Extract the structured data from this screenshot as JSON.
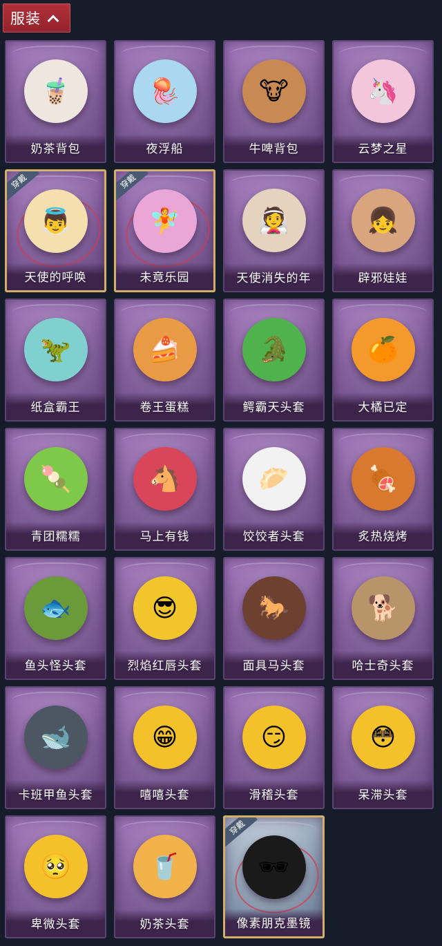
{
  "header": {
    "title": "服装"
  },
  "worn_tag": "穿戴",
  "items": [
    {
      "name": "奶茶背包",
      "icon": "milk-tea-backpack-icon",
      "color": "#f0e6e0",
      "glyph": "🧋",
      "state": "normal"
    },
    {
      "name": "夜浮船",
      "icon": "jellyfish-icon",
      "color": "#a9d8f0",
      "glyph": "🪼",
      "state": "normal"
    },
    {
      "name": "牛啤背包",
      "icon": "cow-beer-barrel-icon",
      "color": "#c88a52",
      "glyph": "🐮",
      "state": "normal"
    },
    {
      "name": "云梦之星",
      "icon": "unicorn-cloud-icon",
      "color": "#f4c6dc",
      "glyph": "🦄",
      "state": "normal"
    },
    {
      "name": "天使的呼唤",
      "icon": "angel-doll-icon",
      "color": "#f6dfae",
      "glyph": "👼",
      "state": "worn"
    },
    {
      "name": "未竟乐园",
      "icon": "pink-hair-doll-icon",
      "color": "#e9a6d6",
      "glyph": "🧚",
      "state": "worn"
    },
    {
      "name": "天使消失的年",
      "icon": "veiled-angel-doll-icon",
      "color": "#e6d3bf",
      "glyph": "👰",
      "state": "normal"
    },
    {
      "name": "辟邪娃娃",
      "icon": "bun-hair-doll-icon",
      "color": "#d9a57e",
      "glyph": "👧",
      "state": "normal"
    },
    {
      "name": "纸盒霸王",
      "icon": "cardboard-dino-icon",
      "color": "#7fd0cf",
      "glyph": "🦖",
      "state": "normal"
    },
    {
      "name": "卷王蛋糕",
      "icon": "roll-cake-icon",
      "color": "#e99a45",
      "glyph": "🍰",
      "state": "normal"
    },
    {
      "name": "鳄霸天头套",
      "icon": "crocodile-head-icon",
      "color": "#4fb24d",
      "glyph": "🐊",
      "state": "normal"
    },
    {
      "name": "大橘已定",
      "icon": "orange-slice-icon",
      "color": "#f49a2c",
      "glyph": "🍊",
      "state": "normal"
    },
    {
      "name": "青团糯糯",
      "icon": "green-rice-ball-icon",
      "color": "#7ec94a",
      "glyph": "🍡",
      "state": "normal"
    },
    {
      "name": "马上有钱",
      "icon": "red-horse-head-icon",
      "color": "#d9465a",
      "glyph": "🐴",
      "state": "normal"
    },
    {
      "name": "饺饺者头套",
      "icon": "dumpling-head-icon",
      "color": "#f2f2f2",
      "glyph": "🥟",
      "state": "normal"
    },
    {
      "name": "炙热烧烤",
      "icon": "bbq-meat-icon",
      "color": "#d9782f",
      "glyph": "🍖",
      "state": "normal"
    },
    {
      "name": "鱼头怪头套",
      "icon": "fish-head-mask-icon",
      "color": "#6b9a3a",
      "glyph": "🐟",
      "state": "normal"
    },
    {
      "name": "烈焰红唇头套",
      "icon": "yellow-pikachu-mask-icon",
      "color": "#f2c62a",
      "glyph": "😎",
      "state": "normal"
    },
    {
      "name": "面具马头套",
      "icon": "horse-mask-icon",
      "color": "#6e4030",
      "glyph": "🐎",
      "state": "normal"
    },
    {
      "name": "哈士奇头套",
      "icon": "husky-mask-icon",
      "color": "#b8946a",
      "glyph": "🐕",
      "state": "normal"
    },
    {
      "name": "卡班甲鱼头套",
      "icon": "dark-fish-head-icon",
      "color": "#4d5663",
      "glyph": "🐋",
      "state": "normal"
    },
    {
      "name": "嘻嘻头套",
      "icon": "grinning-emoji-head-icon",
      "color": "#f4c12b",
      "glyph": "😁",
      "state": "normal"
    },
    {
      "name": "滑稽头套",
      "icon": "smirk-emoji-head-icon",
      "color": "#f4c12b",
      "glyph": "😏",
      "state": "normal"
    },
    {
      "name": "呆滞头套",
      "icon": "stunned-emoji-head-icon",
      "color": "#f4c12b",
      "glyph": "😳",
      "state": "normal"
    },
    {
      "name": "卑微头套",
      "icon": "humble-emoji-head-icon",
      "color": "#f4c12b",
      "glyph": "🥺",
      "state": "normal"
    },
    {
      "name": "奶茶头套",
      "icon": "milk-tea-head-icon",
      "color": "#f2b24a",
      "glyph": "🥤",
      "state": "normal"
    },
    {
      "name": "像素朋克墨镜",
      "icon": "pixel-sunglasses-icon",
      "color": "#1a1a1a",
      "glyph": "🕶",
      "state": "worn-glass"
    }
  ]
}
